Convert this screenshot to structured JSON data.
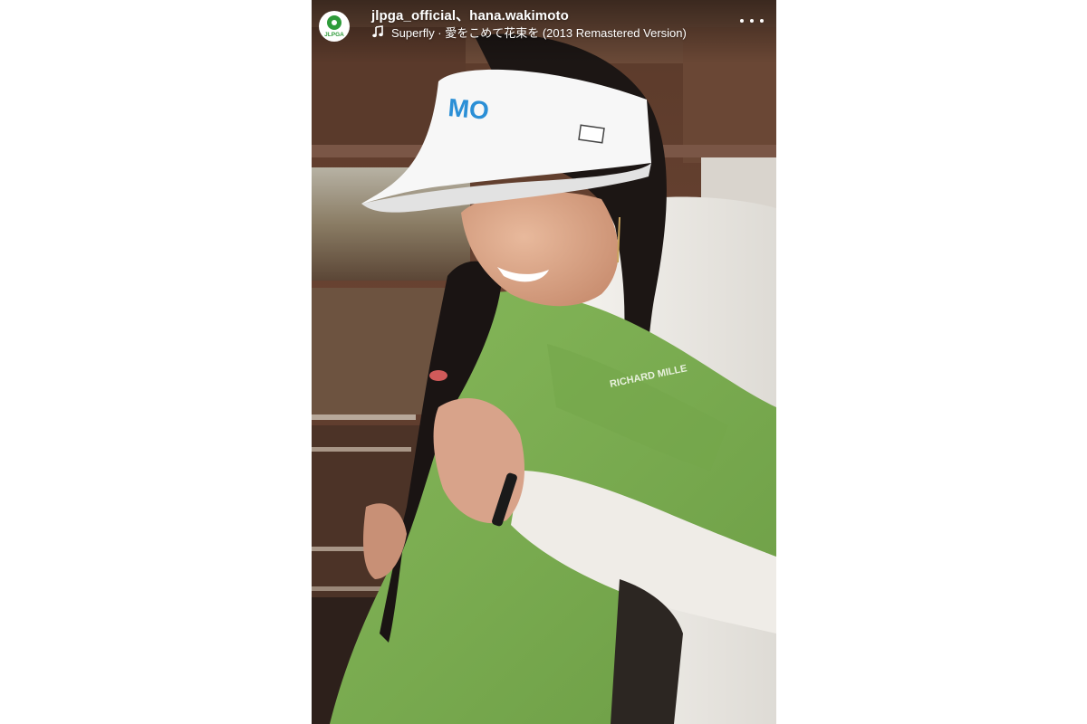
{
  "story": {
    "accounts": "jlpga_official、hana.wakimoto",
    "music": {
      "icon": "music-note-icon",
      "text": "Superfly · 愛をこめて花束を (2013 Remastered Version)"
    },
    "avatar": {
      "label": "JLPGA",
      "icon": "jlpga-logo-icon"
    },
    "more_icon": "more-options-icon",
    "image": {
      "visor_text": "MO",
      "sleeve_text": "RICHARD MILLE"
    }
  },
  "colors": {
    "jacket_green": "#7fae52",
    "visor_text": "#2b8fd6",
    "logo_green": "#2e9b3a"
  }
}
